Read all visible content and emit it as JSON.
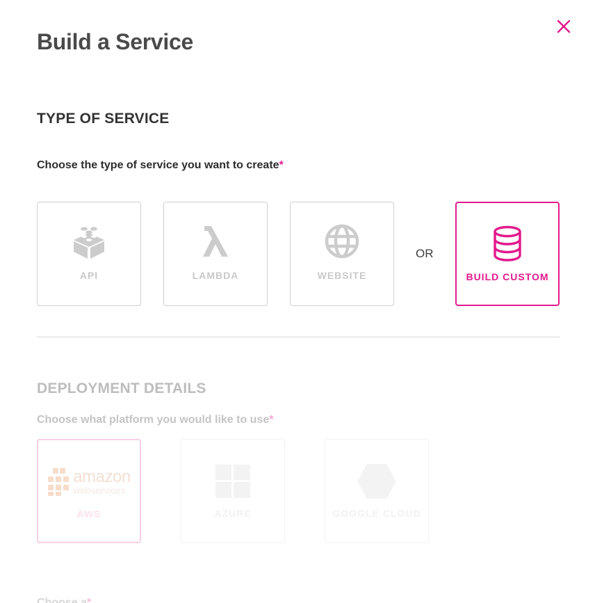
{
  "dialog": {
    "title": "Build a Service",
    "close_icon": "close-icon"
  },
  "type_section": {
    "heading": "TYPE OF SERVICE",
    "prompt": "Choose the type of service you want to create",
    "required_marker": "*",
    "or_text": "OR",
    "options": [
      {
        "label": "API",
        "icon": "blocks-icon",
        "selected": false
      },
      {
        "label": "LAMBDA",
        "icon": "lambda-icon",
        "selected": false
      },
      {
        "label": "WEBSITE",
        "icon": "globe-icon",
        "selected": false
      },
      {
        "label": "BUILD CUSTOM",
        "icon": "database-icon",
        "selected": true
      }
    ]
  },
  "deployment_section": {
    "heading": "DEPLOYMENT DETAILS",
    "prompt": "Choose what platform you would like to use",
    "required_marker": "*",
    "options": [
      {
        "label": "AWS",
        "icon": "amazon-web-services-logo",
        "logo_word": "amazon",
        "logo_sub": "webservices",
        "selected": true
      },
      {
        "label": "AZURE",
        "icon": "windows-icon",
        "selected": false
      },
      {
        "label": "GOOGLE CLOUD",
        "icon": "google-cloud-hexagon-icon",
        "selected": false
      }
    ]
  },
  "next_section": {
    "prompt": "Choose a",
    "required_marker": "*"
  },
  "colors": {
    "accent": "#e3198c",
    "muted_icon": "#cccccc",
    "text": "#3d3d3d"
  }
}
